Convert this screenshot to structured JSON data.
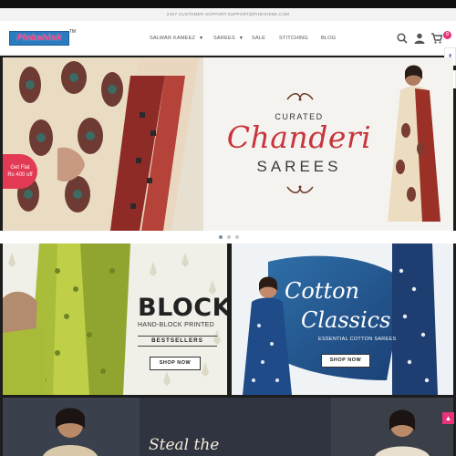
{
  "support_bar": {
    "text": "24X7 CUSTOMER SUPPORT:SUPPORT@PINKSHINK.COM"
  },
  "brand": {
    "name": "Pinkshink",
    "tm": "TM",
    "color": "#e8327a",
    "bg": "#2a7bc0"
  },
  "nav": {
    "items": [
      {
        "label": "SALWAR KAMEEZ",
        "has_dropdown": true
      },
      {
        "label": "SAREES",
        "has_dropdown": true
      },
      {
        "label": "SALE",
        "has_dropdown": false
      },
      {
        "label": "STITCHING",
        "has_dropdown": false
      },
      {
        "label": "BLOG",
        "has_dropdown": false
      }
    ],
    "icons": [
      "search-icon",
      "user-icon",
      "cart-icon"
    ],
    "cart_count": "0"
  },
  "social": {
    "facebook": "f",
    "twitter": "t"
  },
  "hero": {
    "curated": "CURATED",
    "title": "Chanderi",
    "subtitle": "SAREES",
    "promo_line1": "Get Flat",
    "promo_line2": "Rs 400 off",
    "accent": "#c8343b",
    "slide_count": 3,
    "active_slide": 1
  },
  "block_banner": {
    "title": "BLOCK",
    "subtitle": "HAND-BLOCK PRINTED",
    "tag": "BESTSELLERS",
    "button": "SHOP NOW"
  },
  "cotton_banner": {
    "title_line1": "Cotton",
    "title_line2": "Classics",
    "subtitle": "ESSENTIAL COTTON SAREES",
    "button": "SHOP NOW"
  },
  "bottom_banner": {
    "title": "Steal the"
  },
  "scroll_top": {
    "icon": "chevron-up-icon"
  }
}
